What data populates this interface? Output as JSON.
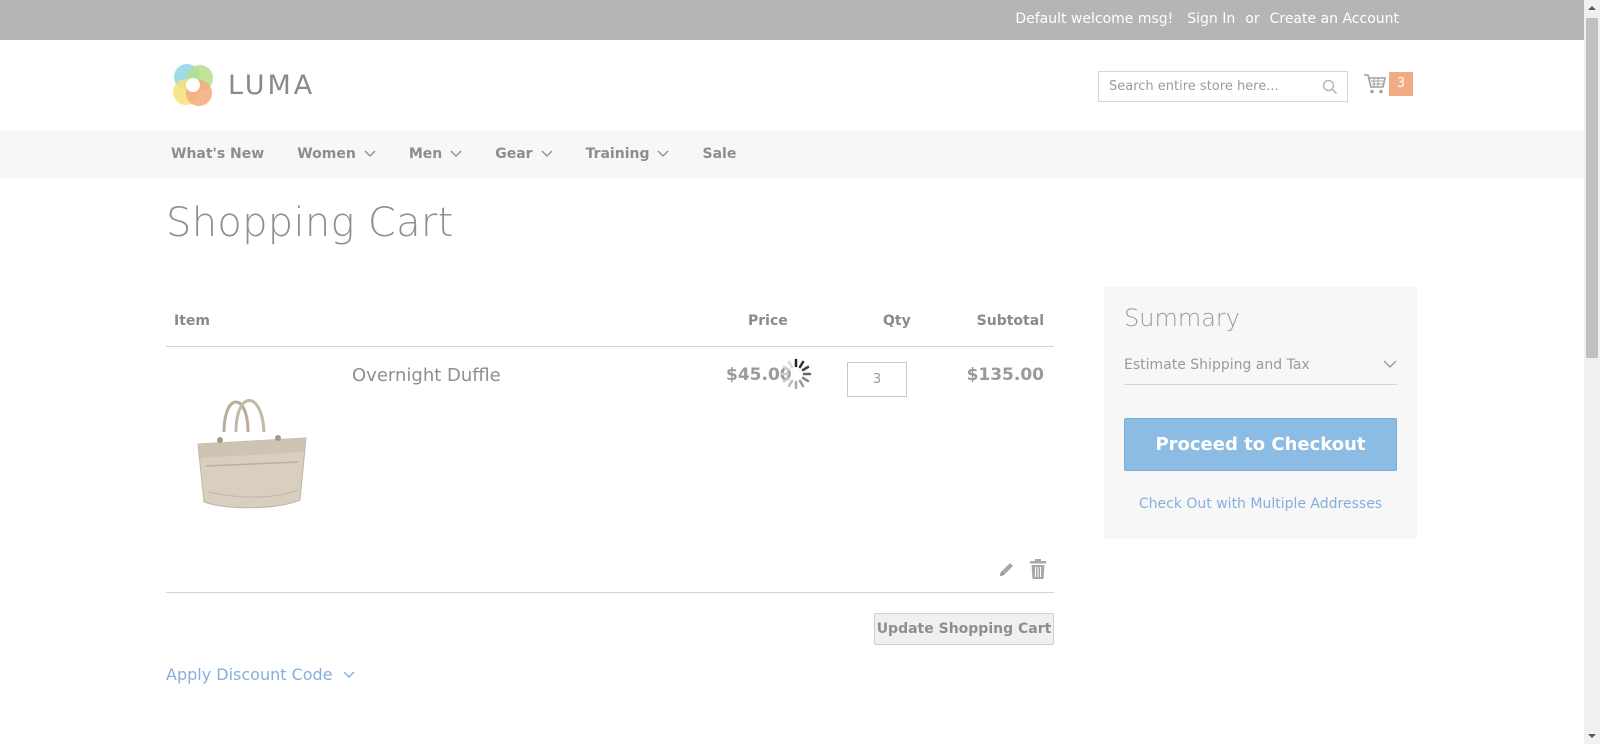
{
  "topbar": {
    "welcome": "Default welcome msg!",
    "sign_in": "Sign In",
    "or": "or",
    "create_account": "Create an Account"
  },
  "header": {
    "logo_text": "LUMA",
    "search_placeholder": "Search entire store here...",
    "cart_count": "3"
  },
  "nav": {
    "items": [
      {
        "label": "What's New",
        "has_dropdown": false
      },
      {
        "label": "Women",
        "has_dropdown": true
      },
      {
        "label": "Men",
        "has_dropdown": true
      },
      {
        "label": "Gear",
        "has_dropdown": true
      },
      {
        "label": "Training",
        "has_dropdown": true
      },
      {
        "label": "Sale",
        "has_dropdown": false
      }
    ]
  },
  "page": {
    "title": "Shopping Cart"
  },
  "cart": {
    "headers": {
      "item": "Item",
      "price": "Price",
      "qty": "Qty",
      "subtotal": "Subtotal"
    },
    "items": [
      {
        "name": "Overnight Duffle",
        "price": "$45.00",
        "qty": "3",
        "subtotal": "$135.00"
      }
    ],
    "update_button": "Update Shopping Cart",
    "discount_label": "Apply Discount Code"
  },
  "summary": {
    "title": "Summary",
    "estimate_label": "Estimate Shipping and Tax",
    "checkout_button": "Proceed to Checkout",
    "multi_address_link": "Check Out with Multiple Addresses"
  },
  "colors": {
    "topbar_bg": "#b5b5b5",
    "nav_bg": "#f7f7f7",
    "checkout_blue": "#8cbbe3",
    "link_blue": "#86aedc",
    "cart_badge": "#f2ac84"
  }
}
